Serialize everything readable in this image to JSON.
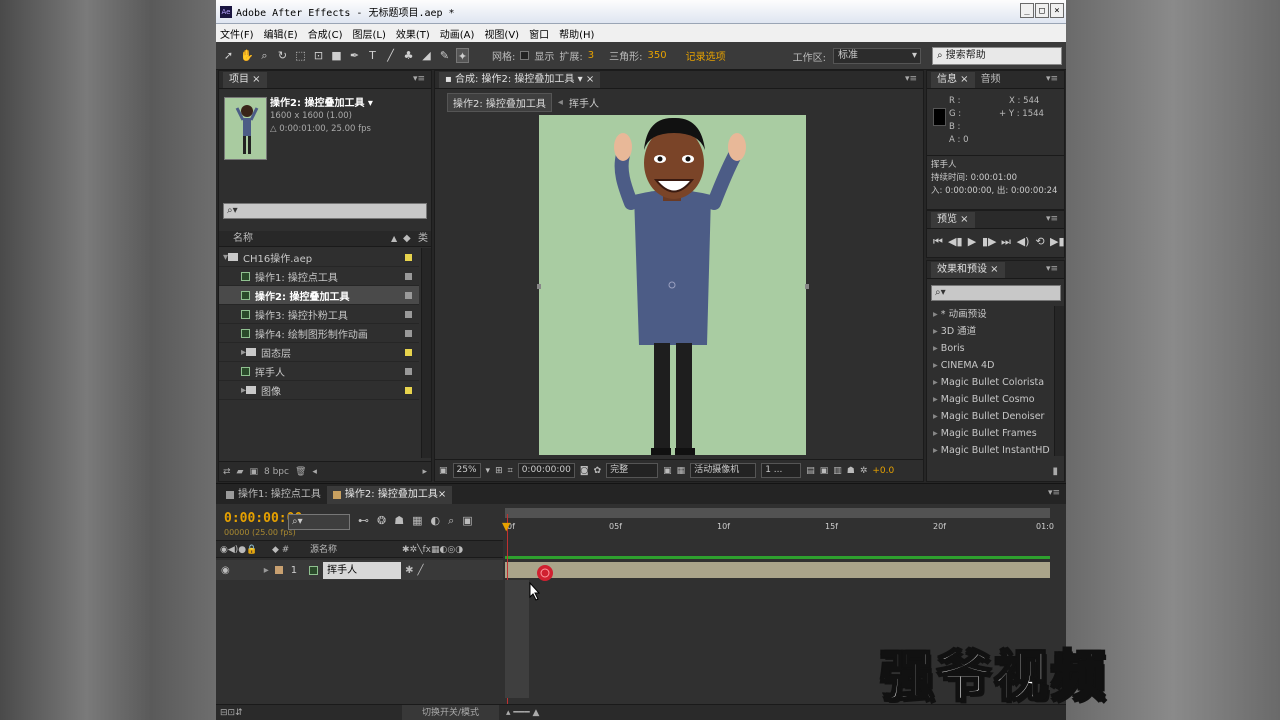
{
  "window": {
    "logo": "Ae",
    "title": "Adobe After Effects - 无标题项目.aep *",
    "buttons": [
      "_",
      "□",
      "×"
    ]
  },
  "menu": [
    "文件(F)",
    "编辑(E)",
    "合成(C)",
    "图层(L)",
    "效果(T)",
    "动画(A)",
    "视图(V)",
    "窗口",
    "帮助(H)"
  ],
  "toolbar": {
    "tools": [
      "pointer-icon",
      "hand-icon",
      "zoom-icon",
      "rotate-icon",
      "camera-orbit-icon",
      "pan-behind-icon",
      "rectangle-icon",
      "pen-icon",
      "text-icon",
      "brush-icon",
      "clone-stamp-icon",
      "eraser-icon",
      "roto-brush-icon",
      "puppet-pin-icon"
    ],
    "grid_label": "网格:",
    "show_label": "显示",
    "expand_label": "扩展:",
    "expand_value": "3",
    "triangles_label": "三角形:",
    "triangles_value": "350",
    "record_label": "记录选项",
    "workspace_label": "工作区:",
    "workspace_value": "标准",
    "help_placeholder": "搜索帮助"
  },
  "project": {
    "tab": "项目",
    "comp_name": "操作2: 操控叠加工具 ▾",
    "comp_size": "1600 x 1600 (1.00)",
    "comp_duration": "△ 0:00:01:00, 25.00 fps",
    "search": "⌕▾",
    "col_name": "名称",
    "col_type": "类",
    "items": [
      {
        "name": "CH16操作.aep",
        "type": "folder",
        "indent": 0,
        "label": "#e8d44d",
        "selected": false
      },
      {
        "name": "操作1: 操控点工具",
        "type": "comp",
        "indent": 1,
        "label": "#9a9a9a",
        "selected": false
      },
      {
        "name": "操作2: 操控叠加工具",
        "type": "comp",
        "indent": 1,
        "label": "#9a9a9a",
        "selected": true
      },
      {
        "name": "操作3: 操控扑粉工具",
        "type": "comp",
        "indent": 1,
        "label": "#9a9a9a",
        "selected": false
      },
      {
        "name": "操作4: 绘制图形制作动画",
        "type": "comp",
        "indent": 1,
        "label": "#9a9a9a",
        "selected": false
      },
      {
        "name": "固态层",
        "type": "folder",
        "indent": 1,
        "label": "#e8d44d",
        "selected": false
      },
      {
        "name": "挥手人",
        "type": "comp",
        "indent": 1,
        "label": "#9a9a9a",
        "selected": false
      },
      {
        "name": "图像",
        "type": "folder",
        "indent": 1,
        "label": "#e8d44d",
        "selected": false
      }
    ],
    "bpc": "8 bpc"
  },
  "viewer": {
    "tab": "合成: 操作2: 操控叠加工具",
    "crumb_active": "操作2: 操控叠加工具",
    "crumb_next": "挥手人",
    "zoom": "25%",
    "time": "0:00:00:00",
    "quality": "完整",
    "camera": "活动摄像机",
    "views": "1 ...",
    "exposure": "+0.0"
  },
  "info": {
    "tabs": [
      "信息",
      "音频"
    ],
    "r": "R :",
    "g": "G :",
    "b": "B :",
    "a": "A : 0",
    "x": "X : 544",
    "y": "+ Y : 1544",
    "layer": "挥手人",
    "duration": "持续时间: 0:00:01:00",
    "inout": "入: 0:00:00:00, 出: 0:00:00:24"
  },
  "preview": {
    "tab": "预览"
  },
  "effects": {
    "tab": "效果和预设",
    "search": "⌕▾",
    "items": [
      "* 动画预设",
      "3D 通道",
      "Boris",
      "CINEMA 4D",
      "Magic Bullet Colorista",
      "Magic Bullet Cosmo",
      "Magic Bullet Denoiser",
      "Magic Bullet Frames",
      "Magic Bullet InstantHD"
    ]
  },
  "timeline": {
    "tabs": [
      {
        "label": "操作1: 操控点工具",
        "color": "#9a9a9a"
      },
      {
        "label": "操作2: 操控叠加工具",
        "color": "#c8a060"
      }
    ],
    "timecode": "0:00:00:00",
    "fps": "00000 (25.00 fps)",
    "search": "⌕▾",
    "source_col": "源名称",
    "layer_num": "1",
    "layer_name": "挥手人",
    "ticks": [
      "0f",
      "05f",
      "10f",
      "15f",
      "20f",
      "01:0"
    ],
    "toggle_label": "切换开关/模式"
  },
  "watermark": "强爷视频"
}
